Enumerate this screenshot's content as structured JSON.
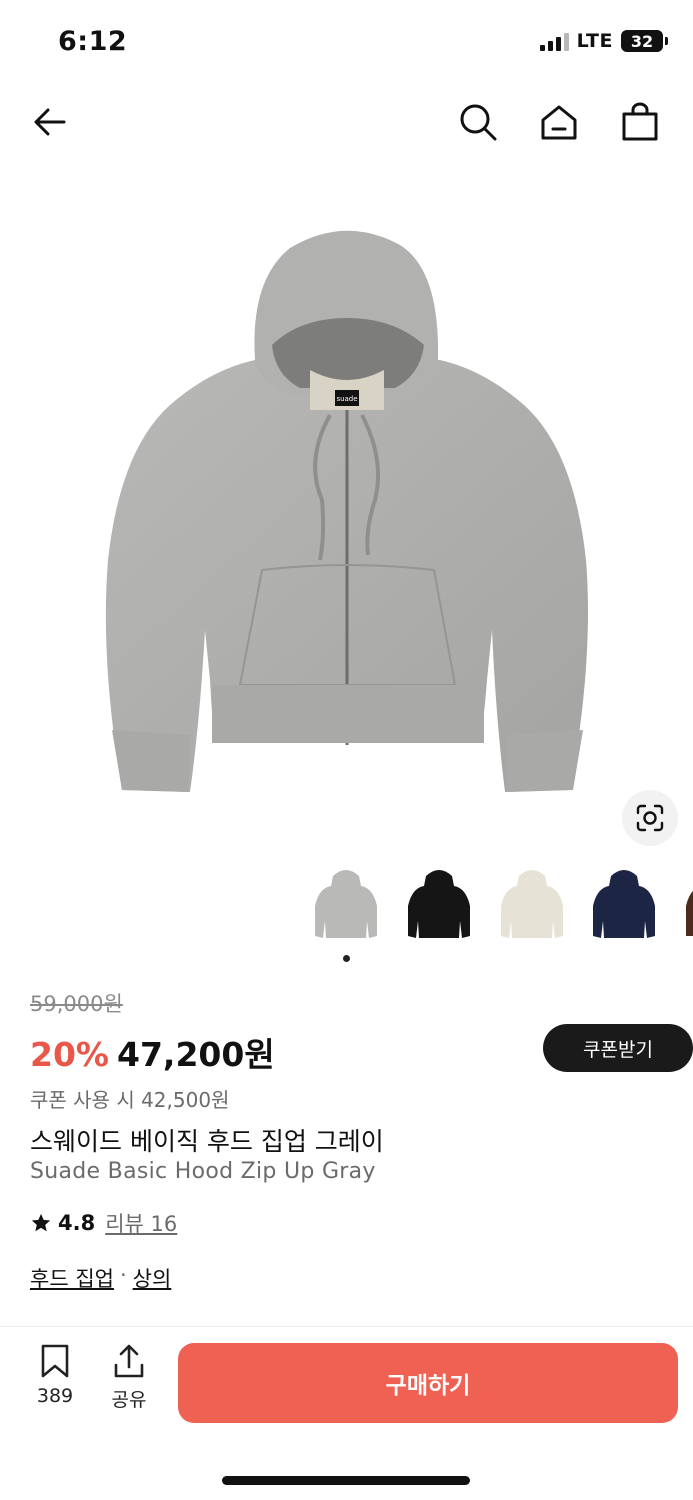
{
  "status_bar": {
    "time": "6:12",
    "network": "LTE",
    "battery": "32"
  },
  "nav": {
    "back_icon": "arrow-left-icon",
    "search_icon": "search-icon",
    "home_icon": "home-icon",
    "bag_icon": "shopping-bag-icon"
  },
  "gallery": {
    "current_index": 1,
    "thumbnails": [
      {
        "color": "#b9b9b7",
        "name": "gray"
      },
      {
        "color": "#151515",
        "name": "black"
      },
      {
        "color": "#e6e2d6",
        "name": "ivory"
      },
      {
        "color": "#1c2543",
        "name": "navy"
      },
      {
        "color": "#4b2c1c",
        "name": "brown"
      }
    ]
  },
  "price": {
    "original": "59,000원",
    "discount": "20%",
    "sale": "47,200원",
    "coupon_price": "쿠폰 사용 시 42,500원",
    "coupon_button": "쿠폰받기"
  },
  "product": {
    "name_ko": "스웨이드 베이직 후드 집업 그레이",
    "name_en": "Suade Basic Hood Zip Up Gray",
    "brand_tag": "suade"
  },
  "rating": {
    "score": "4.8",
    "review_label": "리뷰 16"
  },
  "categories": {
    "first": "후드 집업",
    "separator": "·",
    "second": "상의"
  },
  "bottom_bar": {
    "bookmark_count": "389",
    "share_label": "공유",
    "buy_label": "구매하기"
  },
  "colors": {
    "accent": "#e8574a",
    "buy_button": "#ef6152",
    "dark": "#1a1a1a"
  }
}
